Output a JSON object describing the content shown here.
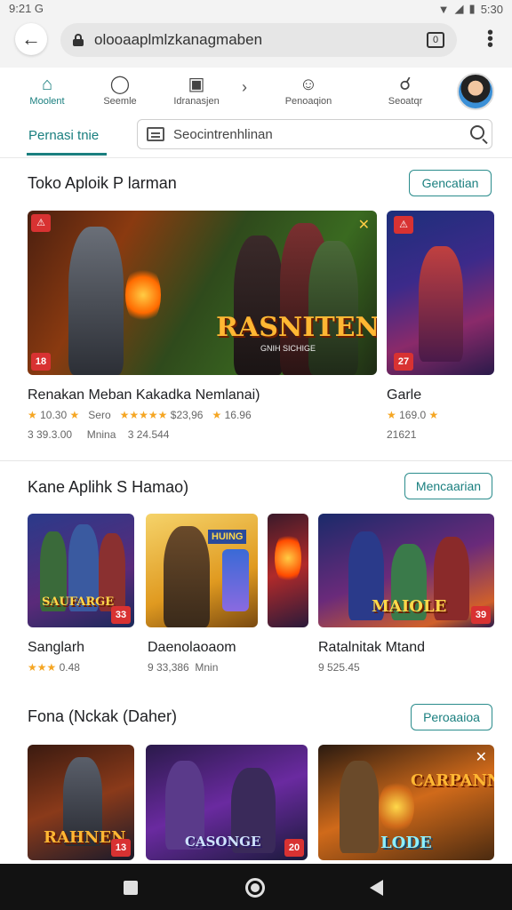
{
  "status": {
    "time": "9:21 G",
    "clock": "5:30"
  },
  "browser": {
    "url": "olooaaplmlzkanagmaben",
    "tab_count": "0"
  },
  "topnav": {
    "items": [
      {
        "label": "Moolent",
        "icon": "home-icon"
      },
      {
        "label": "Seemle",
        "icon": "chat-icon"
      },
      {
        "label": "Idranasjen",
        "icon": "store-icon"
      },
      {
        "label": "Penoaqion",
        "icon": "smiley-icon"
      },
      {
        "label": "Seoatqr",
        "icon": "search-icon"
      }
    ]
  },
  "subbar": {
    "tab_label": "Pernasi tnie",
    "search_placeholder": "Seocintrenhlinan"
  },
  "sections": [
    {
      "title": "Toko Aploik P larman",
      "button": "Gencatian",
      "cards": [
        {
          "art_text": "RASNITEN",
          "art_sub": "GNIH SICHIGE",
          "badge": "18"
        },
        {
          "badge": "27"
        }
      ],
      "items": [
        {
          "title": "Renakan Meban Kakadka Nemlanai)",
          "rating": "10.30",
          "price_label": "Sero",
          "rating2": "$23,96",
          "rating3": "16.96",
          "downloads": "3 39.3.00",
          "size": "Mnina",
          "extra": "3 24.544"
        },
        {
          "title": "Garle",
          "rating": "169.0",
          "downloads": "21621"
        }
      ]
    },
    {
      "title": "Kane Aplihk S Hamao)",
      "button": "Mencaarian",
      "cards": [
        {
          "art_text": "SAUFARGE",
          "badge": "33"
        },
        {
          "art_text": "HUING",
          "badge": ""
        },
        {
          "art_text": "",
          "badge": ""
        },
        {
          "art_text": "MAIOLE",
          "badge": "39"
        }
      ],
      "items": [
        {
          "title": "Sanglarh",
          "rating": "0.48"
        },
        {
          "title": "Daenolaoaom",
          "rating": "9 33,386",
          "size": "Mnin"
        },
        {
          "title": "Ratalnitak Mtand",
          "rating": "9 525.45"
        }
      ]
    },
    {
      "title": "Fona (Nckak (Daher)",
      "button": "Peroaaioa",
      "cards": [
        {
          "art_text": "RAHNEN",
          "badge": "13"
        },
        {
          "art_text": "CASONGE",
          "badge": "20"
        },
        {
          "art_text": "CARPANN",
          "art_sub": "LODE",
          "badge": ""
        }
      ]
    }
  ],
  "colors": {
    "accent": "#1a7f7f",
    "badge_red": "#d83232",
    "star": "#f5a623"
  }
}
